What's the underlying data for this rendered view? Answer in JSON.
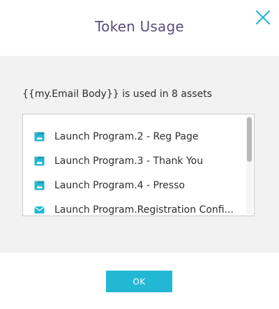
{
  "dialog": {
    "title": "Token Usage",
    "close_icon": "close-icon"
  },
  "summary": {
    "text": "{{my.Email Body}} is used in 8 assets"
  },
  "assets": {
    "items": [
      {
        "label": "Launch Program.2 - Reg Page",
        "icon": "landing-page-icon"
      },
      {
        "label": "Launch Program.3 - Thank You",
        "icon": "landing-page-icon"
      },
      {
        "label": "Launch Program.4 - Presso",
        "icon": "landing-page-icon"
      },
      {
        "label": "Launch Program.Registration Confi...",
        "icon": "email-icon"
      }
    ]
  },
  "footer": {
    "ok_label": "OK"
  },
  "colors": {
    "accent": "#22b8d4",
    "title": "#5a4f7a",
    "body_bg": "#f2f2f2"
  }
}
